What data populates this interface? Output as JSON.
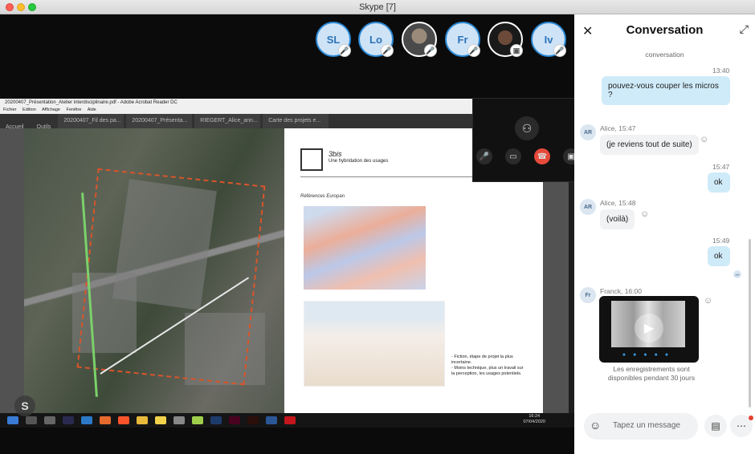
{
  "window": {
    "title": "Skype [7]"
  },
  "participants": [
    {
      "initials": "SL"
    },
    {
      "initials": "Lo"
    },
    {
      "initials": ""
    },
    {
      "initials": "Fr"
    },
    {
      "initials": ""
    },
    {
      "initials": "Iv"
    }
  ],
  "acrobat": {
    "title": "20200407_Présentation_Atelier interdisciplinaire.pdf - Adobe Acrobat Reader DC",
    "menu": [
      "Fichier",
      "Edition",
      "Affichage",
      "Fenêtre",
      "Aide"
    ],
    "home": "Accueil",
    "tools": "Outils",
    "tabs": [
      "20200407_Fil des pa...",
      "20200407_Présenta...",
      "RIEGERT_Alice_ann...",
      "Carte des projets e..."
    ]
  },
  "slide": {
    "logo_title": "3bis",
    "logo_sub": "Une hybridation des usages",
    "references": "Références Europan",
    "caption": "- Fiction, étape de projet la plus incertaine.\n- Moins technique, plus un travail sur la perception, les usages potentiels."
  },
  "taskbar": {
    "time": "16:24",
    "date": "07/04/2020"
  },
  "panel": {
    "title": "Conversation",
    "subtitle": "conversation",
    "messages": [
      {
        "time": "13:40",
        "text": "pouvez-vous couper les micros ?"
      },
      {
        "author": "AR",
        "meta": "Alice, 15:47",
        "text": "(je reviens tout de suite)"
      },
      {
        "time": "15:47",
        "text": "ok"
      },
      {
        "author": "AR",
        "meta": "Alice, 15:48",
        "text": "(voilà)"
      },
      {
        "time": "15:49",
        "text": "ok"
      },
      {
        "author": "Fr",
        "meta": "Franck, 16:00",
        "note": "Les enregistrements sont disponibles pendant 30 jours"
      }
    ],
    "input_placeholder": "Tapez un message",
    "read_receipt": "AR"
  }
}
